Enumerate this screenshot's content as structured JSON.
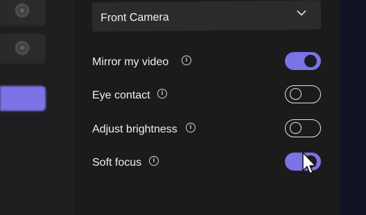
{
  "camera": {
    "selected": "Front Camera",
    "icon": "chevron-down-icon"
  },
  "settings": [
    {
      "label": "Mirror my video",
      "state": "on",
      "info_icon": "info-icon"
    },
    {
      "label": "Eye contact",
      "state": "off",
      "info_icon": "info-icon"
    },
    {
      "label": "Adjust brightness",
      "state": "off",
      "info_icon": "info-icon"
    },
    {
      "label": "Soft focus",
      "state": "on",
      "info_icon": "info-icon"
    }
  ],
  "colors": {
    "accent": "#7b73e6",
    "panel": "#1b1b1b",
    "dropdown": "#2b2b2b"
  }
}
